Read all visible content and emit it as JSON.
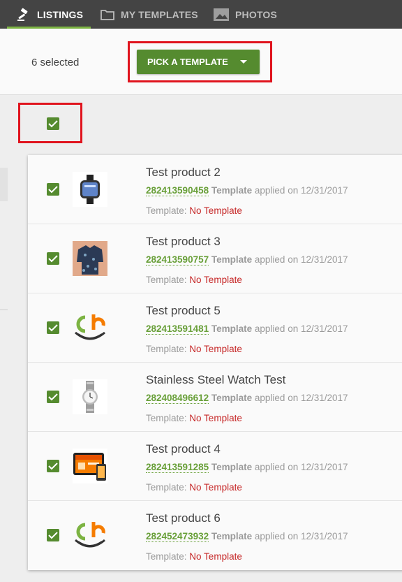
{
  "nav": {
    "tabs": [
      {
        "label": "LISTINGS",
        "icon": "gavel-icon",
        "active": true
      },
      {
        "label": "MY TEMPLATES",
        "icon": "folder-icon",
        "active": false
      },
      {
        "label": "PHOTOS",
        "icon": "image-icon",
        "active": false
      }
    ]
  },
  "actionbar": {
    "selected_text": "6 selected",
    "pick_template_label": "PICK A TEMPLATE"
  },
  "select_all": {
    "checked": true
  },
  "colors": {
    "accent": "#558b2f",
    "link": "#689f38",
    "highlight": "#e0141e",
    "none": "#c62828",
    "nav_bg": "#444444"
  },
  "listings": [
    {
      "title": "Test product 2",
      "item_id": "282413590458",
      "applied_word": "Template",
      "applied_text": "applied on 12/31/2017",
      "template_label": "Template:",
      "template_value": "No Template",
      "thumb": "smartwatch-image",
      "checked": true
    },
    {
      "title": "Test product 3",
      "item_id": "282413590757",
      "applied_word": "Template",
      "applied_text": "applied on 12/31/2017",
      "template_label": "Template:",
      "template_value": "No Template",
      "thumb": "shirt-image",
      "checked": true
    },
    {
      "title": "Test product 5",
      "item_id": "282413591481",
      "applied_word": "Template",
      "applied_text": "applied on 12/31/2017",
      "template_label": "Template:",
      "template_value": "No Template",
      "thumb": "logo-image",
      "checked": true
    },
    {
      "title": "Stainless Steel Watch Test",
      "item_id": "282408496612",
      "applied_word": "Template",
      "applied_text": "applied on 12/31/2017",
      "template_label": "Template:",
      "template_value": "No Template",
      "thumb": "watch-image",
      "checked": true
    },
    {
      "title": "Test product 4",
      "item_id": "282413591285",
      "applied_word": "Template",
      "applied_text": "applied on 12/31/2017",
      "template_label": "Template:",
      "template_value": "No Template",
      "thumb": "devices-image",
      "checked": true
    },
    {
      "title": "Test product 6",
      "item_id": "282452473932",
      "applied_word": "Template",
      "applied_text": "applied on 12/31/2017",
      "template_label": "Template:",
      "template_value": "No Template",
      "thumb": "logo-image",
      "checked": true
    }
  ]
}
